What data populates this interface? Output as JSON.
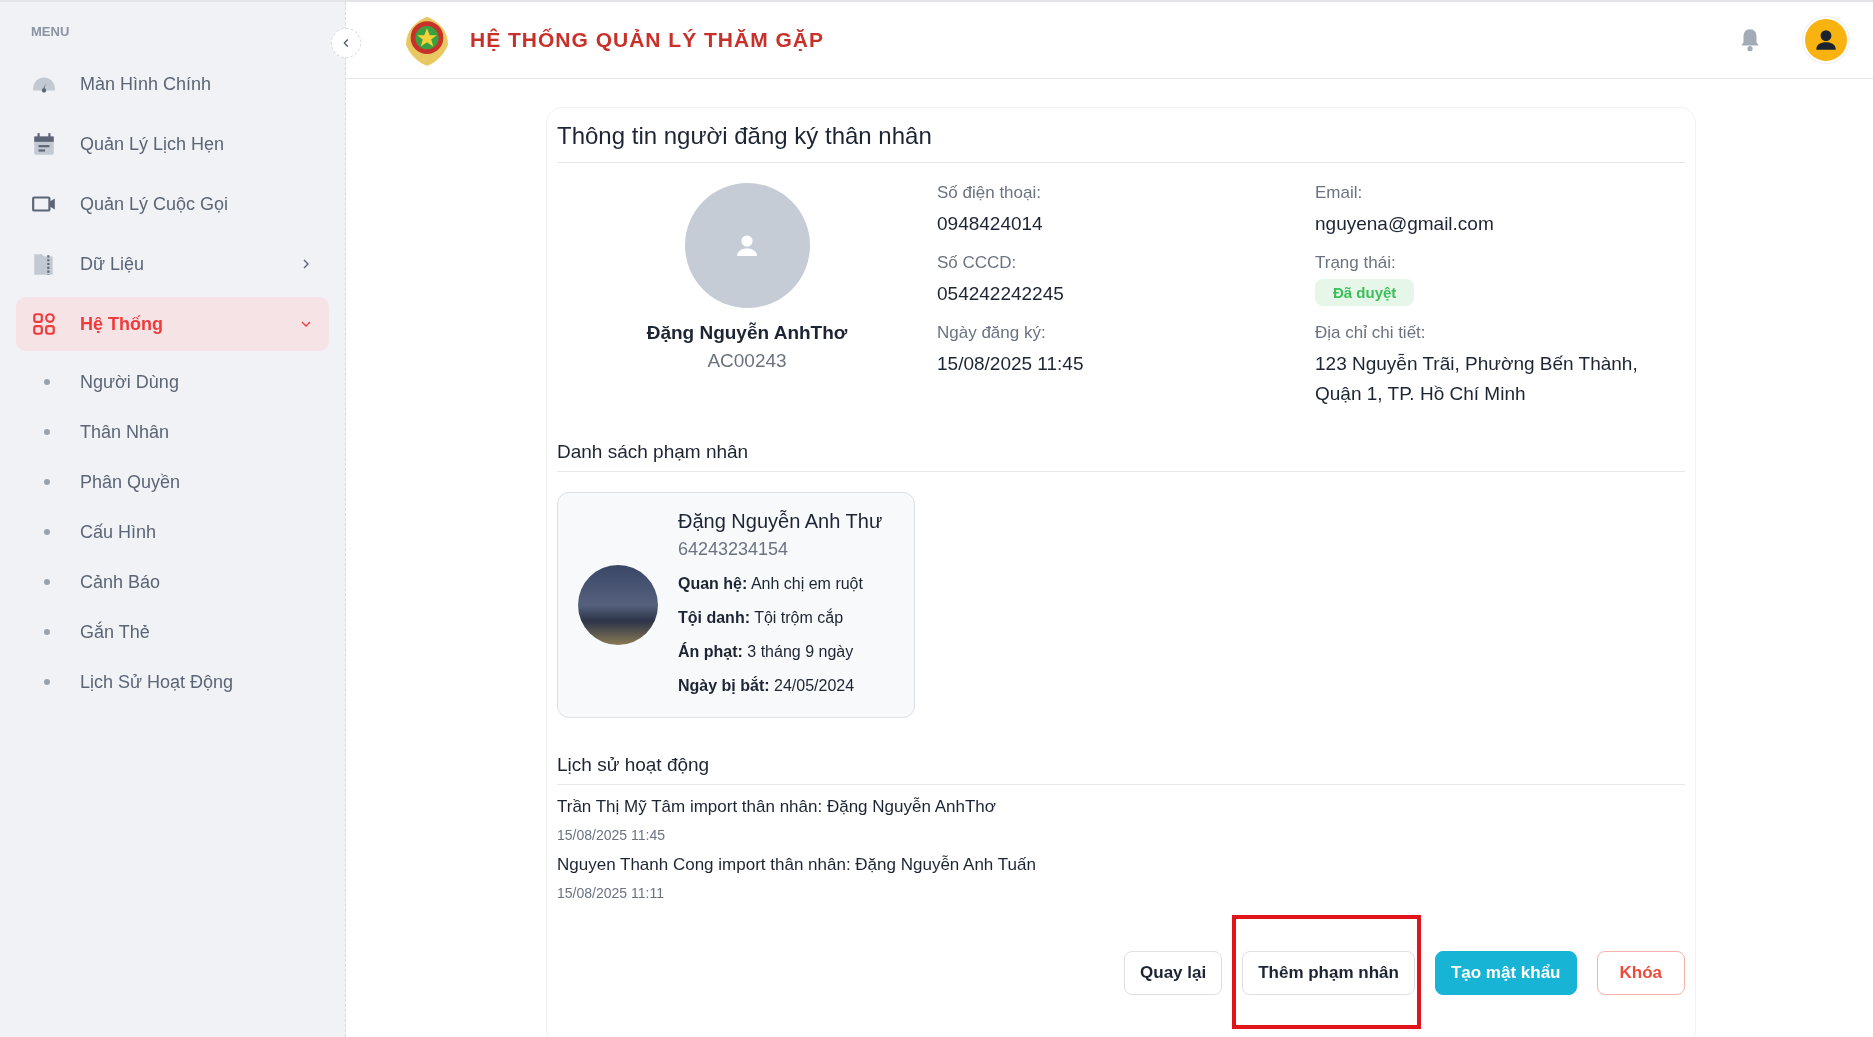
{
  "sidebar": {
    "heading": "MENU",
    "items": [
      {
        "label": "Màn Hình Chính",
        "selected": false,
        "kind": "link"
      },
      {
        "label": "Quản Lý Lịch Hẹn",
        "selected": false,
        "kind": "link"
      },
      {
        "label": "Quản Lý Cuộc Gọi",
        "selected": false,
        "kind": "link"
      },
      {
        "label": "Dữ Liệu",
        "selected": false,
        "kind": "group",
        "expanded": false
      },
      {
        "label": "Hệ Thống",
        "selected": true,
        "kind": "group",
        "expanded": true,
        "children": [
          {
            "label": "Người Dùng",
            "selected": false
          },
          {
            "label": "Thân Nhân",
            "selected": false
          },
          {
            "label": "Phân Quyền",
            "selected": false
          },
          {
            "label": "Cấu Hình",
            "selected": false
          },
          {
            "label": "Cảnh Báo",
            "selected": false
          },
          {
            "label": "Gắn Thẻ",
            "selected": false
          },
          {
            "label": "Lịch Sử Hoạt Động",
            "selected": false
          }
        ]
      }
    ]
  },
  "header": {
    "title": "HỆ THỐNG QUẢN LÝ THĂM GẶP"
  },
  "profile": {
    "title": "Thông tin người đăng ký thân nhân",
    "name": "Đặng Nguyễn AnhThơ",
    "code": "AC00243",
    "fields": [
      {
        "label": "Số điện thoại:",
        "value": "0948424014",
        "kind": "text"
      },
      {
        "label": "Email:",
        "value": "nguyena@gmail.com",
        "kind": "text"
      },
      {
        "label": "Số CCCD:",
        "value": "054242242245",
        "kind": "text"
      },
      {
        "label": "Trạng thái:",
        "value": "Đã duyệt",
        "kind": "status"
      },
      {
        "label": "Ngày đăng ký:",
        "value": "15/08/2025 11:45",
        "kind": "text"
      },
      {
        "label": "Địa chỉ chi tiết:",
        "value": "123 Nguyễn Trãi, Phường Bến Thành, Quận 1, TP. Hồ Chí Minh",
        "kind": "text"
      }
    ]
  },
  "prisoners": {
    "title": "Danh sách phạm nhân",
    "items": [
      {
        "name": "Đặng Nguyễn Anh Thư",
        "code": "64243234154",
        "details": [
          {
            "label": "Quan hệ:",
            "value": "Anh chị em ruột"
          },
          {
            "label": "Tội danh:",
            "value": "Tội trộm cắp"
          },
          {
            "label": "Án phạt:",
            "value": "3 tháng 9 ngày"
          },
          {
            "label": "Ngày bị bắt:",
            "value": "24/05/2024"
          }
        ]
      }
    ]
  },
  "history": {
    "title": "Lịch sử hoạt động",
    "entries": [
      {
        "text": "Trần Thị Mỹ Tâm import thân nhân: Đặng Nguyễn AnhThơ",
        "time": "15/08/2025 11:45"
      },
      {
        "text": "Nguyen Thanh Cong import thân nhân: Đặng Nguyễn Anh Tuấn",
        "time": "15/08/2025 11:11"
      }
    ]
  },
  "buttons": [
    {
      "label": "Quay lại",
      "kind": "outline",
      "highlighted": false
    },
    {
      "label": "Thêm phạm nhân",
      "kind": "outline",
      "highlighted": true
    },
    {
      "label": "Tạo mật khẩu",
      "kind": "primary",
      "highlighted": false
    },
    {
      "label": "Khóa",
      "kind": "danger",
      "highlighted": false
    }
  ]
}
